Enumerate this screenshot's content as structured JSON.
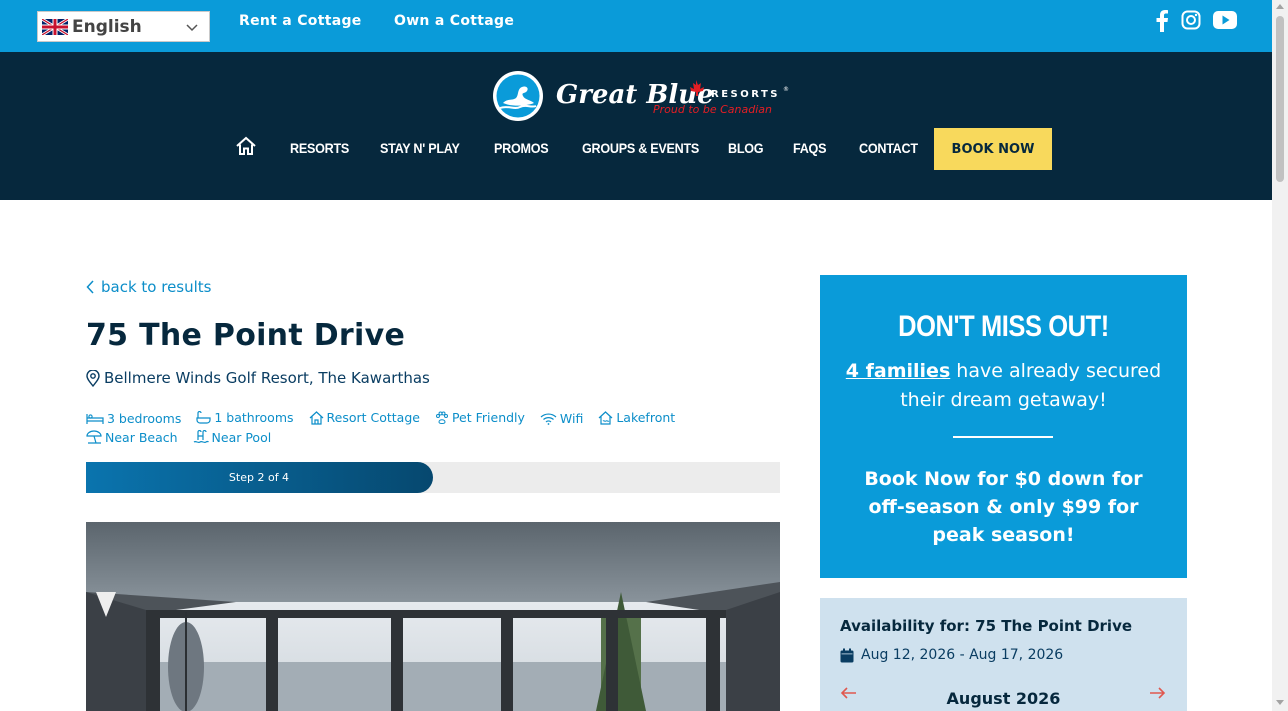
{
  "topbar": {
    "language": "English",
    "links": [
      "Rent a Cottage",
      "Own a Cottage"
    ],
    "social_icons": [
      "facebook-icon",
      "instagram-icon",
      "youtube-icon"
    ]
  },
  "logo": {
    "brand": "Great Blue",
    "resorts": "RESORTS",
    "tagline": "Proud to be Canadian"
  },
  "nav": {
    "items": [
      "RESORTS",
      "STAY N' PLAY",
      "PROMOS",
      "GROUPS & EVENTS",
      "BLOG",
      "FAQS",
      "CONTACT"
    ],
    "book_now": "BOOK NOW"
  },
  "listing": {
    "back": "back to results",
    "title": "75 The Point Drive",
    "location": "Bellmere Winds Golf Resort, The Kawarthas",
    "amenities": [
      {
        "icon": "bed-icon",
        "label": "3 bedrooms"
      },
      {
        "icon": "bath-icon",
        "label": "1 bathrooms"
      },
      {
        "icon": "house-icon",
        "label": "Resort Cottage"
      },
      {
        "icon": "paw-icon",
        "label": "Pet Friendly"
      },
      {
        "icon": "wifi-icon",
        "label": "Wifi"
      },
      {
        "icon": "lakefront-icon",
        "label": "Lakefront"
      },
      {
        "icon": "beach-umbrella-icon",
        "label": "Near Beach"
      },
      {
        "icon": "pool-icon",
        "label": "Near Pool"
      }
    ],
    "progress": {
      "label": "Step 2 of 4",
      "fraction": 0.5
    }
  },
  "promo": {
    "headline": "DON'T MISS OUT!",
    "families": "4 families",
    "families_rest": " have already secured their dream getaway!",
    "offer": "Book Now for $0 down for off-season & only $99 for peak season!"
  },
  "availability": {
    "title": "Availability for: 75 The Point Drive",
    "dates": "Aug 12, 2026 - Aug 17, 2026",
    "month": "August 2026"
  },
  "colors": {
    "topbar": "#0a9bd9",
    "header": "#06283d",
    "book_button": "#f8d95c",
    "link": "#0c8ec9",
    "panel": "#cfe1ee"
  }
}
